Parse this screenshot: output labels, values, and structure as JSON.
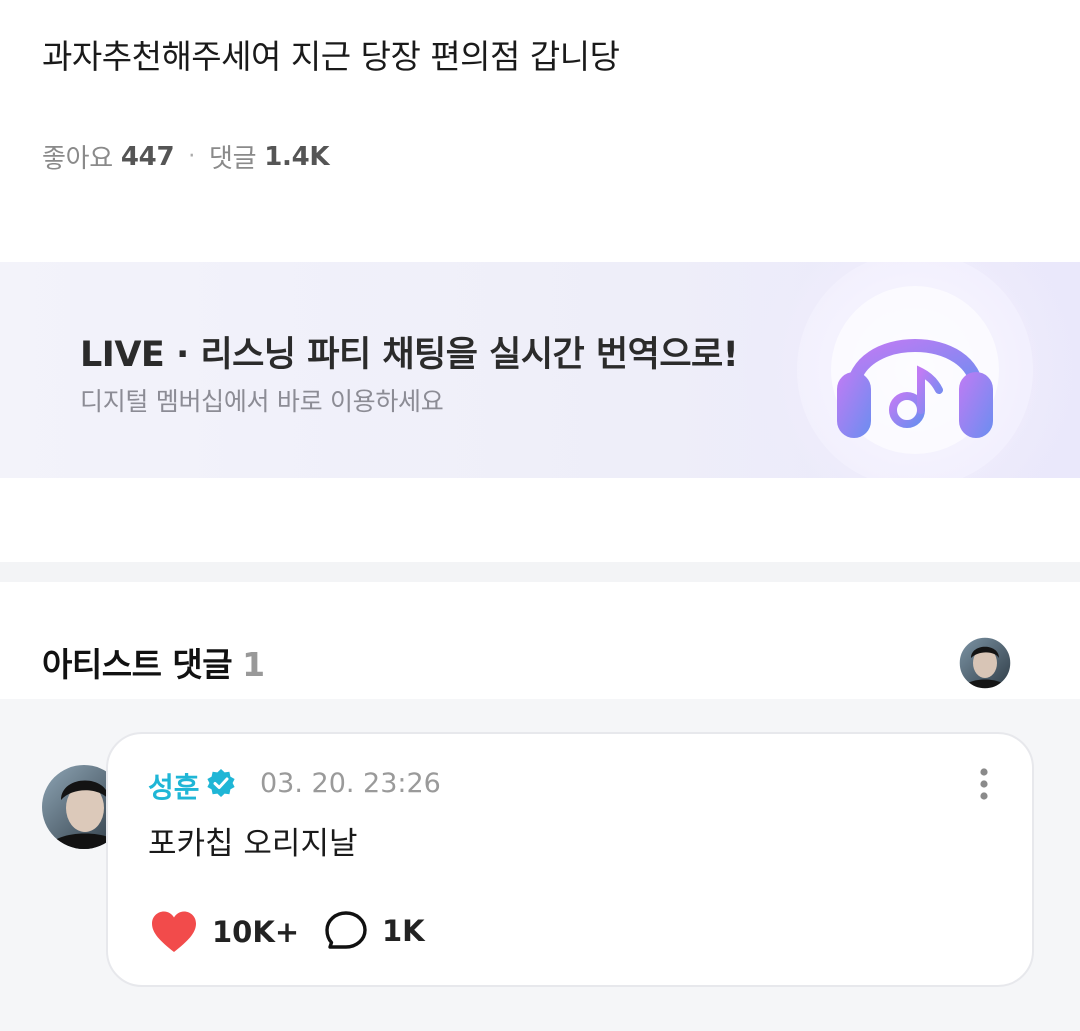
{
  "post": {
    "title": "과자추천해주세여 지근 당장 편의점 갑니당",
    "likes_label": "좋아요",
    "likes_count": "447",
    "separator": "·",
    "comments_label": "댓글",
    "comments_count": "1.4K"
  },
  "banner": {
    "title": "LIVE · 리스닝 파티 채팅을 실시간 번역으로!",
    "subtitle": "디지털 멤버십에서 바로 이용하세요",
    "icon": "headphones-music-note-icon"
  },
  "artist_comments": {
    "title": "아티스트 댓글",
    "count": "1"
  },
  "comment": {
    "author": "성훈",
    "timestamp": "03. 20. 23:26",
    "text": "포카칩 오리지날",
    "likes": "10K+",
    "replies": "1K"
  },
  "colors": {
    "accent": "#1fb6d6",
    "like": "#f24b4b",
    "banner_icon_from": "#c07bf4",
    "banner_icon_to": "#6a8ef0"
  }
}
